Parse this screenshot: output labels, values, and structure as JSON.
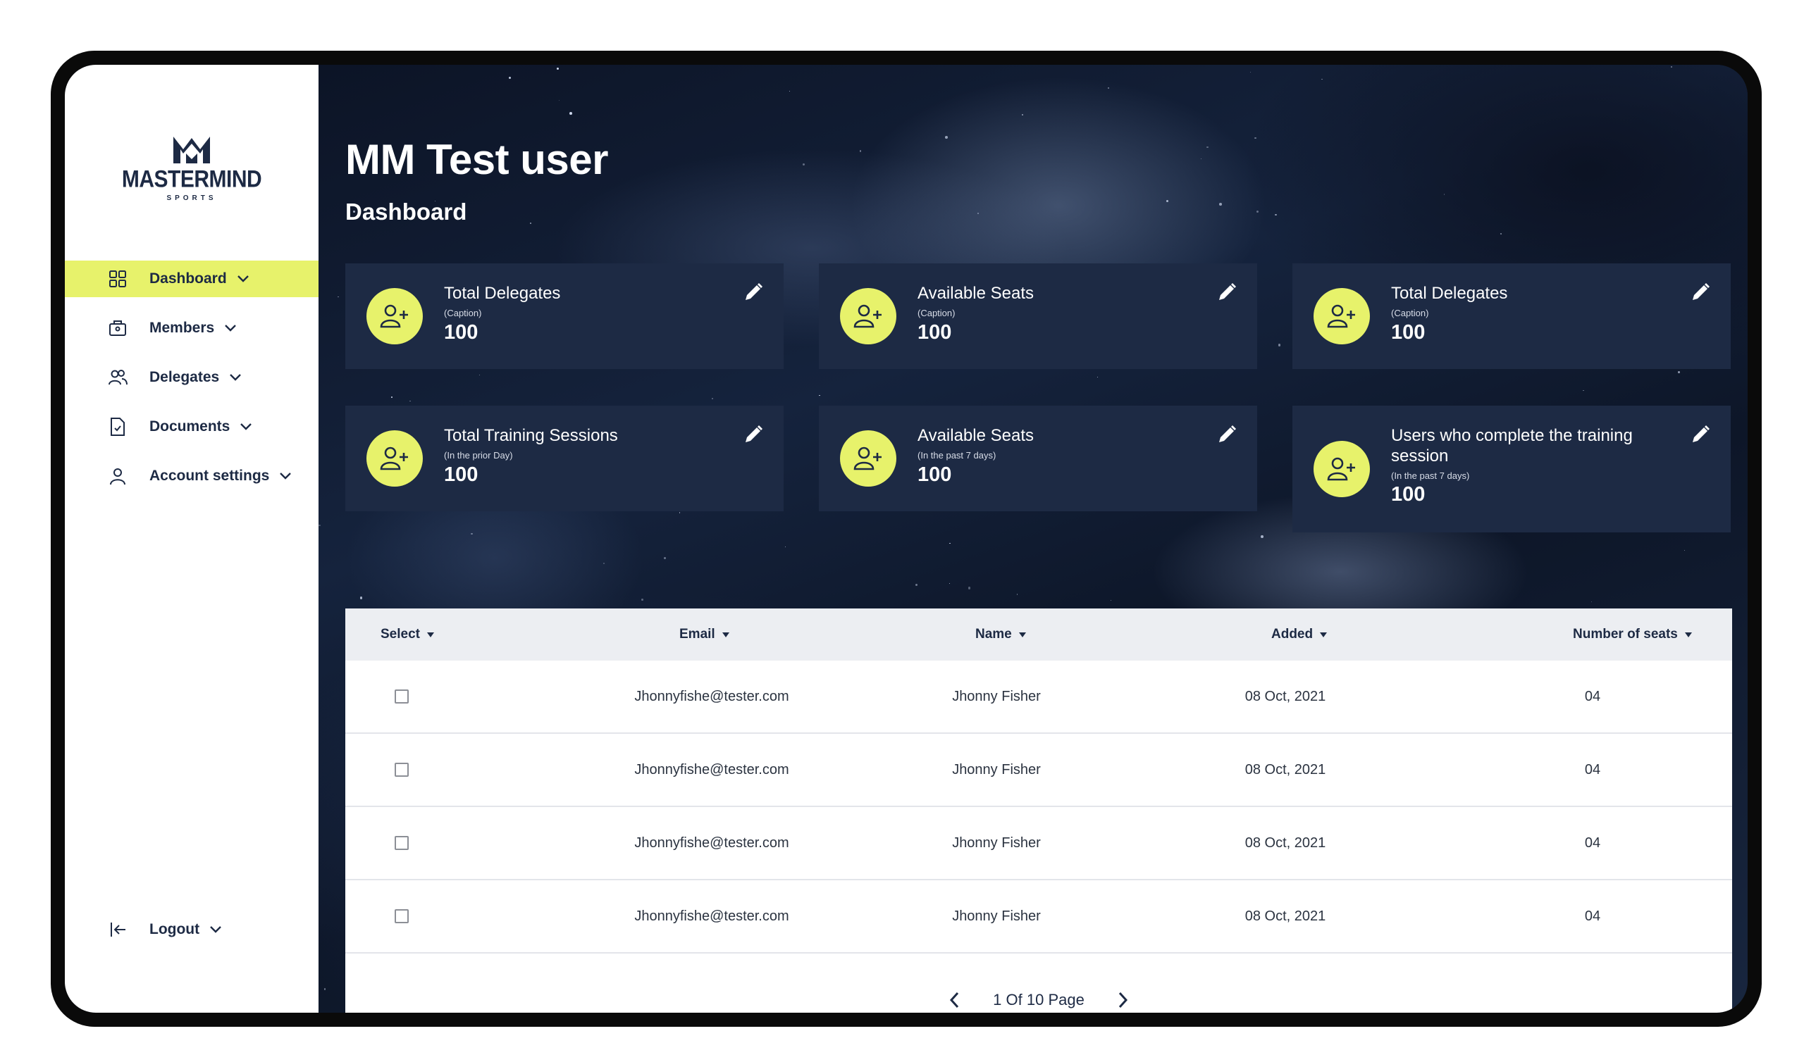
{
  "brand": {
    "name": "MASTERMIND",
    "sub": "SPORTS"
  },
  "sidebar": {
    "items": [
      {
        "label": "Dashboard",
        "icon": "grid-icon",
        "active": true
      },
      {
        "label": "Members",
        "icon": "briefcase-icon"
      },
      {
        "label": "Delegates",
        "icon": "users-icon"
      },
      {
        "label": "Documents",
        "icon": "document-icon"
      },
      {
        "label": "Account settings",
        "icon": "user-icon"
      }
    ],
    "logout": "Logout"
  },
  "header": {
    "title": "MM Test user",
    "subtitle": "Dashboard"
  },
  "cards": [
    {
      "title": "Total Delegates",
      "caption": "(Caption)",
      "value": "100"
    },
    {
      "title": "Available Seats",
      "caption": "(Caption)",
      "value": "100"
    },
    {
      "title": "Total Delegates",
      "caption": "(Caption)",
      "value": "100"
    },
    {
      "title": "Total Training Sessions",
      "caption": "(In the prior Day)",
      "value": "100"
    },
    {
      "title": "Available Seats",
      "caption": "(In the past 7 days)",
      "value": "100"
    },
    {
      "title": "Users who complete the training session",
      "caption": "(In the past 7 days)",
      "value": "100"
    }
  ],
  "table": {
    "columns": [
      "Select",
      "Email",
      "Name",
      "Added",
      "Number of seats"
    ],
    "rows": [
      {
        "email": "Jhonnyfishe@tester.com",
        "name": "Jhonny Fisher",
        "added": "08 Oct, 2021",
        "seats": "04"
      },
      {
        "email": "Jhonnyfishe@tester.com",
        "name": "Jhonny Fisher",
        "added": "08 Oct, 2021",
        "seats": "04"
      },
      {
        "email": "Jhonnyfishe@tester.com",
        "name": "Jhonny Fisher",
        "added": "08 Oct, 2021",
        "seats": "04"
      },
      {
        "email": "Jhonnyfishe@tester.com",
        "name": "Jhonny Fisher",
        "added": "08 Oct, 2021",
        "seats": "04"
      }
    ],
    "pagination": "1 Of 10 Page"
  },
  "colors": {
    "accent": "#e7f26b",
    "navy": "#1d2a44"
  }
}
